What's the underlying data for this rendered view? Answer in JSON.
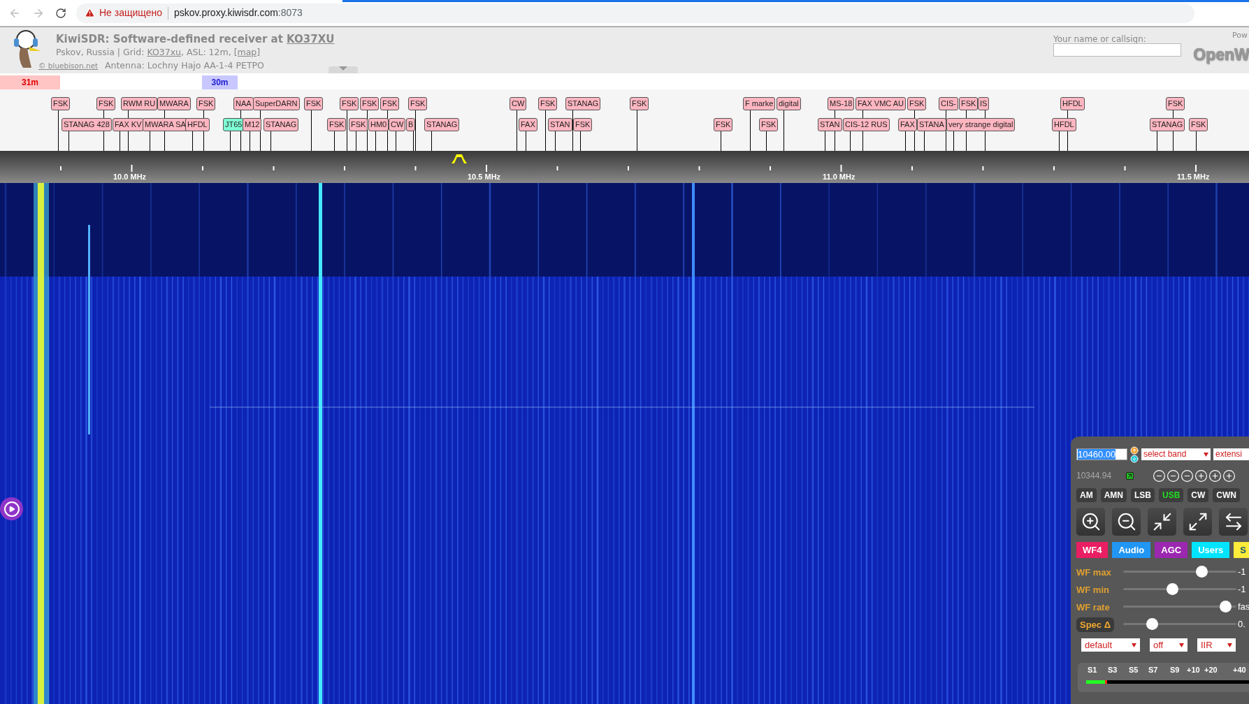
{
  "browser": {
    "security_warning": "Не защищено",
    "url_host": "pskov.proxy.kiwisdr.com",
    "url_port": ":8073"
  },
  "header": {
    "title": "KiwiSDR: Software-defined receiver at",
    "title_link": "KO37XU",
    "location": "Pskov, Russia | Grid:",
    "grid_link": "KO37xu",
    "location_details": ", ASL: 12m,",
    "map_link": "[map]",
    "credit_link": "© bluebison.net",
    "antenna": "Antenna: Lochny Hajo AA-1-4 PETPO",
    "name_label": "Your name or callsign:",
    "powered_by": "Pow",
    "logo_text": "OpenW"
  },
  "bands": [
    {
      "label": "31m",
      "kind": "broadcast"
    },
    {
      "label": "30m",
      "kind": "amateur"
    }
  ],
  "dx_labels": {
    "upper_row": [
      {
        "text": "FSK",
        "color": "#ffb6c1"
      },
      {
        "text": "FSK",
        "color": "#ffb6c1"
      },
      {
        "text": "RWM RU",
        "color": "#ffb6c1"
      },
      {
        "text": "MWARA",
        "color": "#ffb6c1"
      },
      {
        "text": "FSK",
        "color": "#ffb6c1"
      },
      {
        "text": "NAA",
        "color": "#ffb6c1"
      },
      {
        "text": "SuperDARN",
        "color": "#ffb6c1"
      },
      {
        "text": "FSK",
        "color": "#ffb6c1"
      },
      {
        "text": "FSK",
        "color": "#ffb6c1"
      },
      {
        "text": "FSK",
        "color": "#ffb6c1"
      },
      {
        "text": "FSK",
        "color": "#ffb6c1"
      },
      {
        "text": "FSK",
        "color": "#ffb6c1"
      },
      {
        "text": "CW",
        "color": "#ffb6c1"
      },
      {
        "text": "FSK",
        "color": "#ffb6c1"
      },
      {
        "text": "STANAG",
        "color": "#ffb6c1"
      },
      {
        "text": "FSK",
        "color": "#ffb6c1"
      },
      {
        "text": "F marke",
        "color": "#ffb6c1"
      },
      {
        "text": "digital",
        "color": "#ffb6c1"
      },
      {
        "text": "MS-18",
        "color": "#ffb6c1"
      },
      {
        "text": "FAX VMC AU",
        "color": "#ffb6c1"
      },
      {
        "text": "FSK",
        "color": "#ffb6c1"
      },
      {
        "text": "CIS-",
        "color": "#ffb6c1"
      },
      {
        "text": "FSK",
        "color": "#ffb6c1"
      },
      {
        "text": "IS",
        "color": "#ffb6c1"
      },
      {
        "text": "HFDL",
        "color": "#ffb6c1"
      },
      {
        "text": "FSK",
        "color": "#ffb6c1"
      }
    ],
    "lower_row": [
      {
        "text": "STANAG 428",
        "color": "#ffb6c1"
      },
      {
        "text": "FAX KV",
        "color": "#ffb6c1"
      },
      {
        "text": "MWARA SA",
        "color": "#ffb6c1"
      },
      {
        "text": "HFDL",
        "color": "#ffb6c1"
      },
      {
        "text": "JT65",
        "color": "#7fffd4"
      },
      {
        "text": "M12",
        "color": "#ffb6c1"
      },
      {
        "text": "STANAG",
        "color": "#ffb6c1"
      },
      {
        "text": "FSK",
        "color": "#ffb6c1"
      },
      {
        "text": "FSK",
        "color": "#ffb6c1"
      },
      {
        "text": "HM0",
        "color": "#ffb6c1"
      },
      {
        "text": "CW",
        "color": "#ffb6c1"
      },
      {
        "text": "B",
        "color": "#ffb6c1"
      },
      {
        "text": "STANAG",
        "color": "#ffb6c1"
      },
      {
        "text": "FAX",
        "color": "#ffb6c1"
      },
      {
        "text": "STAN",
        "color": "#ffb6c1"
      },
      {
        "text": "FSK",
        "color": "#ffb6c1"
      },
      {
        "text": "FSK",
        "color": "#ffb6c1"
      },
      {
        "text": "FSK",
        "color": "#ffb6c1"
      },
      {
        "text": "STAN",
        "color": "#ffb6c1"
      },
      {
        "text": "CIS-12 RUS",
        "color": "#ffb6c1"
      },
      {
        "text": "FAX",
        "color": "#ffb6c1"
      },
      {
        "text": "STANA",
        "color": "#ffb6c1"
      },
      {
        "text": "very strange digital",
        "color": "#ffb6c1"
      },
      {
        "text": "HFDL",
        "color": "#ffb6c1"
      },
      {
        "text": "STANAG",
        "color": "#ffb6c1"
      },
      {
        "text": "FSK",
        "color": "#ffb6c1"
      }
    ]
  },
  "scale": {
    "ticks": [
      "10.0 MHz",
      "10.5 MHz",
      "11.0 MHz",
      "11.5 MHz"
    ]
  },
  "control_panel": {
    "frequency": "10460.00",
    "band_select": "select band",
    "extension_select": "extensi",
    "secondary_frequency": "10344.94",
    "modes": [
      {
        "label": "AM",
        "selected": false
      },
      {
        "label": "AMN",
        "selected": false
      },
      {
        "label": "LSB",
        "selected": false
      },
      {
        "label": "USB",
        "selected": true
      },
      {
        "label": "CW",
        "selected": false
      },
      {
        "label": "CWN",
        "selected": false
      }
    ],
    "tabs": [
      {
        "label": "WF4",
        "color": "#e91e63"
      },
      {
        "label": "Audio",
        "color": "#2196f3"
      },
      {
        "label": "AGC",
        "color": "#9c27b0"
      },
      {
        "label": "Users",
        "color": "#00e5ff"
      },
      {
        "label": "S",
        "color": "#ffeb3b"
      }
    ],
    "sliders": [
      {
        "label": "WF max",
        "kind": "plain",
        "level": 0.72,
        "reading": "-1"
      },
      {
        "label": "WF min",
        "kind": "plain",
        "level": 0.43,
        "reading": "-1"
      },
      {
        "label": "WF rate",
        "kind": "plain",
        "level": 0.95,
        "reading": "fas"
      },
      {
        "label": "Spec Δ",
        "kind": "button",
        "level": 0.23,
        "reading": "0."
      }
    ],
    "selects": [
      "default",
      "off",
      "IIR"
    ],
    "s_meter": {
      "scale": [
        "S1",
        "S3",
        "S5",
        "S7",
        "S9",
        "+10",
        "+20",
        "+40"
      ],
      "level": 0.12
    }
  }
}
